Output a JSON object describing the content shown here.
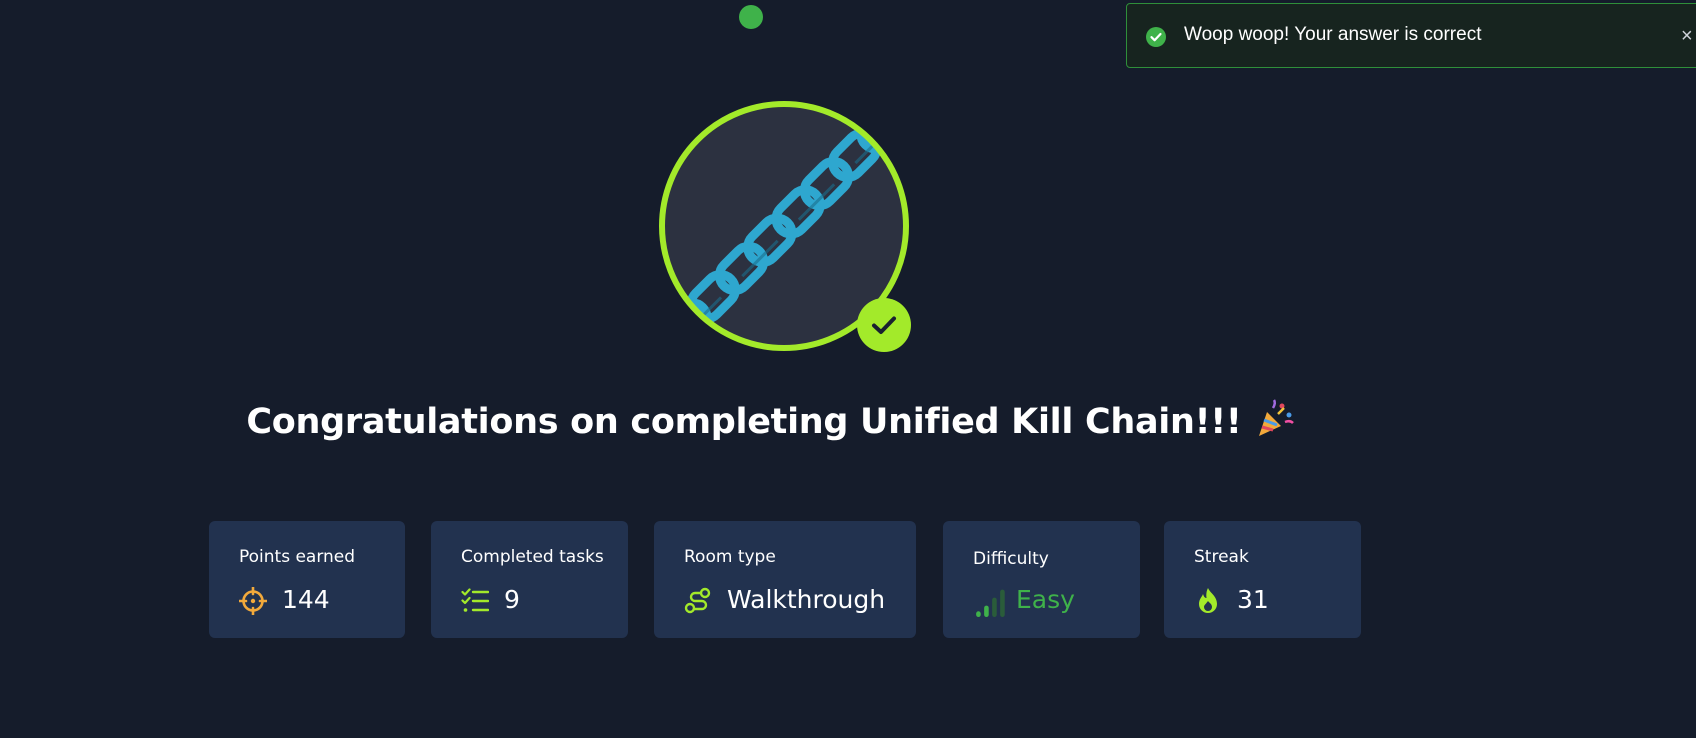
{
  "toast": {
    "message": "Woop woop! Your answer is correct",
    "close_label": "×",
    "status_color": "#3fb24a"
  },
  "badge": {
    "icon": "chain-link-icon",
    "ring_color": "#a3ea2a",
    "chain_color": "#2ea7cf",
    "completed": true
  },
  "title": {
    "text": "Congratulations on completing Unified Kill Chain!!!",
    "emoji_icon": "party-popper-icon"
  },
  "stats": [
    {
      "label": "Points earned",
      "value": "144",
      "icon": "crosshair-icon",
      "icon_color": "#f2a93b"
    },
    {
      "label": "Completed tasks",
      "value": "9",
      "icon": "checklist-icon",
      "icon_color": "#a3ea2a"
    },
    {
      "label": "Room type",
      "value": "Walkthrough",
      "icon": "route-icon",
      "icon_color": "#a3ea2a"
    },
    {
      "label": "Difficulty",
      "value": "Easy",
      "icon": "signal-bars-icon",
      "icon_color": "#3fb24a"
    },
    {
      "label": "Streak",
      "value": "31",
      "icon": "flame-icon",
      "icon_color": "#a3ea2a"
    }
  ]
}
